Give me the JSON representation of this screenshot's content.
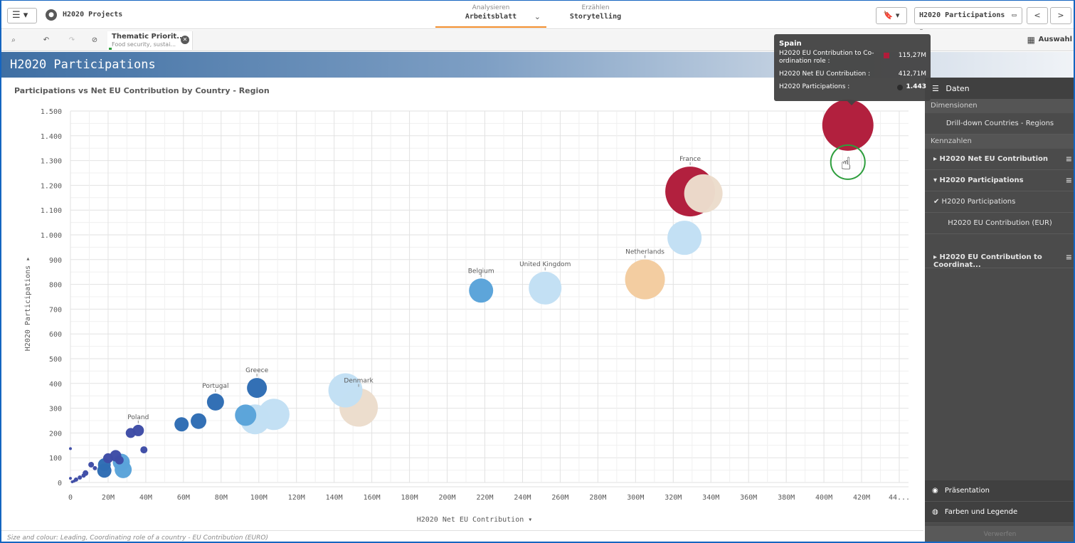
{
  "toolbar": {
    "menu_label": "☰ ▾",
    "app_title": "H2020 Projects",
    "tabs": [
      {
        "sub": "Analysieren",
        "main": "Arbeitsblatt"
      },
      {
        "sub": "Erzählen",
        "main": "Storytelling"
      }
    ],
    "bookmark_label": "🔖 ▾",
    "sheet_selector": "H2020 Participations",
    "prev": "<",
    "next": ">"
  },
  "selections": {
    "chip_title": "Thematic Priorit...",
    "chip_sub": "Food security, sustai...",
    "auswahl": "Auswahl"
  },
  "sheet_title": "H2020 Participations",
  "chart_title_text": "Participations vs Net EU Contribution by Country - Region",
  "footnote": "Size and colour: Leading, Coordinating role of a country - EU Contribution (EURO)",
  "colors": {
    "dark_red": "#b01c3a",
    "beige": "#ecdccc",
    "light_blue": "#c2dff4",
    "peach": "#f3cc9f",
    "mid_blue": "#5aa3d9",
    "dark_blue": "#2f6db4",
    "navy": "#3e4da6"
  },
  "tooltip": {
    "title": "Spain",
    "rows": [
      {
        "label": "H2020 EU Contribution to Co-ordination role :",
        "value": "115,27M"
      },
      {
        "label": "H2020 Net EU Contribution :",
        "value": "412,71M"
      },
      {
        "label": "H2020 Participations :",
        "value": "1.443"
      }
    ]
  },
  "panel": {
    "header": "Daten",
    "dimensions_label": "Dimensionen",
    "dimension_item": "Drill-down Countries - Regions",
    "measures_label": "Kennzahlen",
    "measure1": "H2020 Net EU Contribution",
    "measure2": "H2020 Participations",
    "measure2_opt1": "✔ H2020 Participations",
    "measure2_opt2": "H2020 EU Contribution (EUR)",
    "measure3": "H2020 EU Contribution to Coordinat...",
    "presentation": "Präsentation",
    "colors_legend": "Farben und Legende",
    "footer": "Verwerfen"
  },
  "chart_data": {
    "type": "scatter",
    "title": "Participations vs Net EU Contribution by Country - Region",
    "xlabel": "H2020 Net EU Contribution",
    "ylabel": "H2020 Participations",
    "xlim": [
      0,
      440
    ],
    "ylim": [
      0,
      1500
    ],
    "x_unit": "M",
    "x_ticks": [
      "0",
      "20M",
      "40M",
      "60M",
      "80M",
      "100M",
      "120M",
      "140M",
      "160M",
      "180M",
      "200M",
      "220M",
      "240M",
      "260M",
      "280M",
      "300M",
      "320M",
      "340M",
      "360M",
      "380M",
      "400M",
      "420M",
      "44..."
    ],
    "y_ticks": [
      "0",
      "100",
      "200",
      "300",
      "400",
      "500",
      "600",
      "700",
      "800",
      "900",
      "1.000",
      "1.100",
      "1.200",
      "1.300",
      "1.400",
      "1.500"
    ],
    "grid": true,
    "points": [
      {
        "label": "Spain",
        "x": 412.71,
        "y": 1443,
        "r": 36,
        "color": "#b01c3a"
      },
      {
        "label": "France",
        "x": 329,
        "y": 1175,
        "r": 35,
        "color": "#b01c3a"
      },
      {
        "label": "",
        "x": 336,
        "y": 1167,
        "r": 27,
        "color": "#ecdccc"
      },
      {
        "label": "",
        "x": 326,
        "y": 988,
        "r": 24,
        "color": "#c2dff4"
      },
      {
        "label": "Netherlands",
        "x": 305,
        "y": 820,
        "r": 28,
        "color": "#f3cc9f"
      },
      {
        "label": "United Kingdom",
        "x": 252,
        "y": 785,
        "r": 23,
        "color": "#c2dff4"
      },
      {
        "label": "Belgium",
        "x": 218,
        "y": 775,
        "r": 17,
        "color": "#5aa3d9"
      },
      {
        "label": "Denmark",
        "x": 153,
        "y": 303,
        "r": 27,
        "color": "#ecdccc"
      },
      {
        "label": "",
        "x": 146,
        "y": 372,
        "r": 24,
        "color": "#c2dff4"
      },
      {
        "label": "",
        "x": 108,
        "y": 275,
        "r": 22,
        "color": "#c2dff4"
      },
      {
        "label": "",
        "x": 98,
        "y": 255,
        "r": 21,
        "color": "#c2dff4"
      },
      {
        "label": "",
        "x": 93,
        "y": 272,
        "r": 15,
        "color": "#5aa3d9"
      },
      {
        "label": "Greece",
        "x": 99,
        "y": 382,
        "r": 14,
        "color": "#2f6db4"
      },
      {
        "label": "Portugal",
        "x": 77,
        "y": 325,
        "r": 12,
        "color": "#2f6db4"
      },
      {
        "label": "",
        "x": 68,
        "y": 248,
        "r": 11,
        "color": "#2f6db4"
      },
      {
        "label": "",
        "x": 59,
        "y": 235,
        "r": 10,
        "color": "#2f6db4"
      },
      {
        "label": "Poland",
        "x": 36,
        "y": 210,
        "r": 8,
        "color": "#3e4da6"
      },
      {
        "label": "",
        "x": 32,
        "y": 200,
        "r": 7,
        "color": "#3e4da6"
      },
      {
        "label": "",
        "x": 39,
        "y": 132,
        "r": 5,
        "color": "#3e4da6"
      },
      {
        "label": "",
        "x": 28,
        "y": 52,
        "r": 12,
        "color": "#5aa3d9"
      },
      {
        "label": "",
        "x": 27,
        "y": 82,
        "r": 12,
        "color": "#5aa3d9"
      },
      {
        "label": "",
        "x": 18,
        "y": 48,
        "r": 10,
        "color": "#2f6db4"
      },
      {
        "label": "",
        "x": 18,
        "y": 72,
        "r": 9,
        "color": "#2f6db4"
      },
      {
        "label": "",
        "x": 24,
        "y": 108,
        "r": 8,
        "color": "#3e4da6"
      },
      {
        "label": "",
        "x": 20,
        "y": 98,
        "r": 7,
        "color": "#3e4da6"
      },
      {
        "label": "",
        "x": 26,
        "y": 90,
        "r": 6,
        "color": "#3e4da6"
      },
      {
        "label": "",
        "x": 11,
        "y": 72,
        "r": 4,
        "color": "#3e4da6"
      },
      {
        "label": "",
        "x": 13,
        "y": 58,
        "r": 3,
        "color": "#3e4da6"
      },
      {
        "label": "",
        "x": 8,
        "y": 38,
        "r": 4,
        "color": "#3e4da6"
      },
      {
        "label": "",
        "x": 7,
        "y": 28,
        "r": 3,
        "color": "#3e4da6"
      },
      {
        "label": "",
        "x": 5,
        "y": 20,
        "r": 3,
        "color": "#3e4da6"
      },
      {
        "label": "",
        "x": 3,
        "y": 12,
        "r": 3,
        "color": "#3e4da6"
      },
      {
        "label": "",
        "x": 2,
        "y": 6,
        "r": 2,
        "color": "#3e4da6"
      },
      {
        "label": "",
        "x": 1,
        "y": 3,
        "r": 2,
        "color": "#3e4da6"
      },
      {
        "label": "",
        "x": 0,
        "y": 17,
        "r": 2,
        "color": "#3e4da6"
      },
      {
        "label": "",
        "x": 0,
        "y": 137,
        "r": 2,
        "color": "#3e4da6"
      }
    ]
  }
}
